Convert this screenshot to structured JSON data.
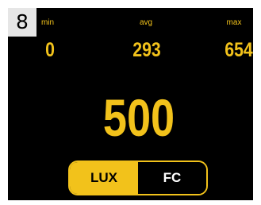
{
  "step_badge": "8",
  "stats": {
    "min": {
      "label": "min",
      "value": "0"
    },
    "avg": {
      "label": "avg",
      "value": "293"
    },
    "max": {
      "label": "max",
      "value": "654"
    }
  },
  "reading": {
    "value": "500"
  },
  "unit_toggle": {
    "options": [
      {
        "label": "LUX",
        "selected": true
      },
      {
        "label": "FC",
        "selected": false
      }
    ]
  },
  "colors": {
    "accent": "#f2c21b",
    "background": "#000000",
    "inactive_text": "#ffffff"
  }
}
